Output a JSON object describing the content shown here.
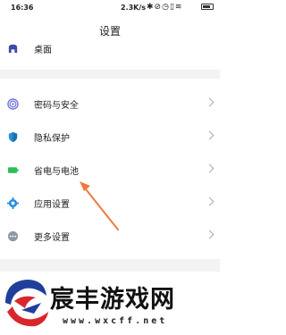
{
  "status_bar": {
    "time": "16:36",
    "network_speed": "2.3K/s",
    "icons": [
      "bluetooth-icon",
      "mute-icon",
      "alarm-icon",
      "sim-icon",
      "wifi-icon",
      "battery-icon"
    ]
  },
  "header": {
    "title": "设置"
  },
  "settings": {
    "items": [
      {
        "label": "桌面",
        "icon": "desktop-icon",
        "color": "#3b4aa8"
      },
      {
        "label": "密码与安全",
        "icon": "fingerprint-icon",
        "color": "#6b6fd6"
      },
      {
        "label": "隐私保护",
        "icon": "privacy-icon",
        "color": "#2a8fd8"
      },
      {
        "label": "省电与电池",
        "icon": "battery-saver-icon",
        "color": "#2ebd59"
      },
      {
        "label": "应用设置",
        "icon": "gear-icon",
        "color": "#2b8fe0"
      },
      {
        "label": "更多设置",
        "icon": "more-icon",
        "color": "#8f97a6"
      }
    ]
  },
  "annotation": {
    "arrow_color": "#f07a3c"
  },
  "watermark": {
    "brand": "宸丰游戏网",
    "url": "www.wxcff.net",
    "logo_colors": [
      "#d9262b",
      "#1f3f9b"
    ]
  }
}
